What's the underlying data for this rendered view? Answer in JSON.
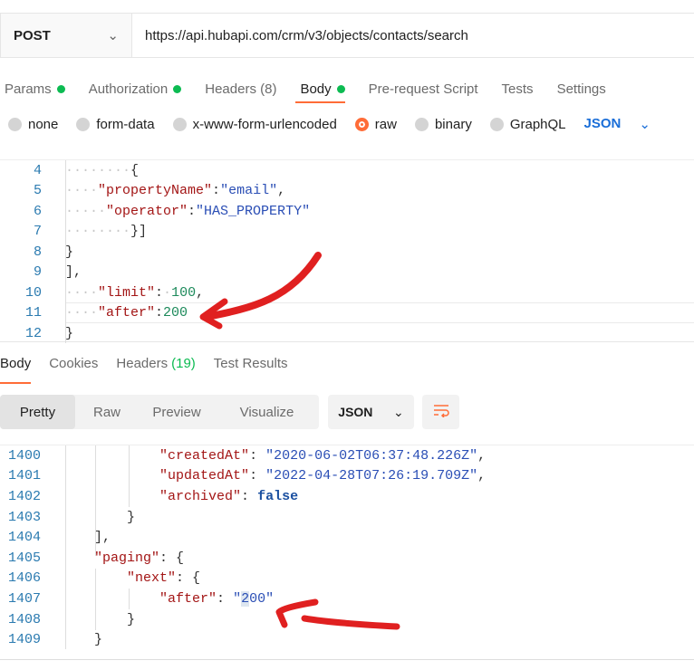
{
  "request": {
    "method": "POST",
    "url": "https://api.hubapi.com/crm/v3/objects/contacts/search"
  },
  "tabs": [
    {
      "label": "Params",
      "dot": true
    },
    {
      "label": "Authorization",
      "dot": true
    },
    {
      "label": "Headers (8)",
      "dot": false
    },
    {
      "label": "Body",
      "dot": true,
      "active": true
    },
    {
      "label": "Pre-request Script",
      "dot": false
    },
    {
      "label": "Tests",
      "dot": false
    },
    {
      "label": "Settings",
      "dot": false
    }
  ],
  "body_types": [
    {
      "label": "none"
    },
    {
      "label": "form-data"
    },
    {
      "label": "x-www-form-urlencoded"
    },
    {
      "label": "raw",
      "selected": true
    },
    {
      "label": "binary"
    },
    {
      "label": "GraphQL"
    }
  ],
  "body_format": "JSON",
  "editor_lines": [
    {
      "n": "4",
      "t": [
        [
          "d",
          "········"
        ],
        [
          "p",
          "{"
        ]
      ]
    },
    {
      "n": "5",
      "t": [
        [
          "d",
          "····"
        ],
        [
          "k",
          "\"propertyName\""
        ],
        [
          "p",
          ":"
        ],
        [
          "s",
          "\"email\""
        ],
        [
          "p",
          ","
        ]
      ]
    },
    {
      "n": "6",
      "t": [
        [
          "d",
          "·····"
        ],
        [
          "k",
          "\"operator\""
        ],
        [
          "p",
          ":"
        ],
        [
          "s",
          "\"HAS_PROPERTY\""
        ]
      ]
    },
    {
      "n": "7",
      "t": [
        [
          "d",
          "········"
        ],
        [
          "p",
          "}]"
        ]
      ]
    },
    {
      "n": "8",
      "t": [
        [
          "p",
          "}"
        ]
      ]
    },
    {
      "n": "9",
      "t": [
        [
          "p",
          "],"
        ]
      ]
    },
    {
      "n": "10",
      "t": [
        [
          "d",
          "····"
        ],
        [
          "k",
          "\"limit\""
        ],
        [
          "p",
          ":"
        ],
        [
          "d",
          "·"
        ],
        [
          "n",
          "100"
        ],
        [
          "p",
          ","
        ]
      ]
    },
    {
      "n": "11",
      "t": [
        [
          "d",
          "····"
        ],
        [
          "k",
          "\"after\""
        ],
        [
          "p",
          ":"
        ],
        [
          "n",
          "200"
        ]
      ]
    },
    {
      "n": "12",
      "t": [
        [
          "p",
          "}"
        ]
      ]
    }
  ],
  "response_tabs": [
    {
      "label": "Body",
      "active": true
    },
    {
      "label": "Cookies"
    },
    {
      "label": "Headers",
      "count": "(19)"
    },
    {
      "label": "Test Results"
    }
  ],
  "view_modes": [
    "Pretty",
    "Raw",
    "Preview",
    "Visualize"
  ],
  "response_format": "JSON",
  "response_lines": [
    {
      "n": "1400",
      "t": [
        [
          "p",
          "            "
        ],
        [
          "k",
          "\"createdAt\""
        ],
        [
          "p",
          ": "
        ],
        [
          "s",
          "\"2020-06-02T06:37:48.226Z\""
        ],
        [
          "p",
          ","
        ]
      ]
    },
    {
      "n": "1401",
      "t": [
        [
          "p",
          "            "
        ],
        [
          "k",
          "\"updatedAt\""
        ],
        [
          "p",
          ": "
        ],
        [
          "s",
          "\"2022-04-28T07:26:19.709Z\""
        ],
        [
          "p",
          ","
        ]
      ]
    },
    {
      "n": "1402",
      "t": [
        [
          "p",
          "            "
        ],
        [
          "k",
          "\"archived\""
        ],
        [
          "p",
          ": "
        ],
        [
          "b",
          "false"
        ]
      ]
    },
    {
      "n": "1403",
      "t": [
        [
          "p",
          "        }"
        ]
      ]
    },
    {
      "n": "1404",
      "t": [
        [
          "p",
          "    ],"
        ]
      ]
    },
    {
      "n": "1405",
      "t": [
        [
          "p",
          "    "
        ],
        [
          "k",
          "\"paging\""
        ],
        [
          "p",
          ": {"
        ]
      ]
    },
    {
      "n": "1406",
      "t": [
        [
          "p",
          "        "
        ],
        [
          "k",
          "\"next\""
        ],
        [
          "p",
          ": {"
        ]
      ]
    },
    {
      "n": "1407",
      "t": [
        [
          "p",
          "            "
        ],
        [
          "k",
          "\"after\""
        ],
        [
          "p",
          ": "
        ],
        [
          "s",
          "\""
        ],
        [
          "s hl",
          "2"
        ],
        [
          "s",
          "00\""
        ]
      ]
    },
    {
      "n": "1408",
      "t": [
        [
          "p",
          "        }"
        ]
      ]
    },
    {
      "n": "1409",
      "t": [
        [
          "p",
          "    }"
        ]
      ]
    }
  ],
  "annotation_color": "#e02020"
}
